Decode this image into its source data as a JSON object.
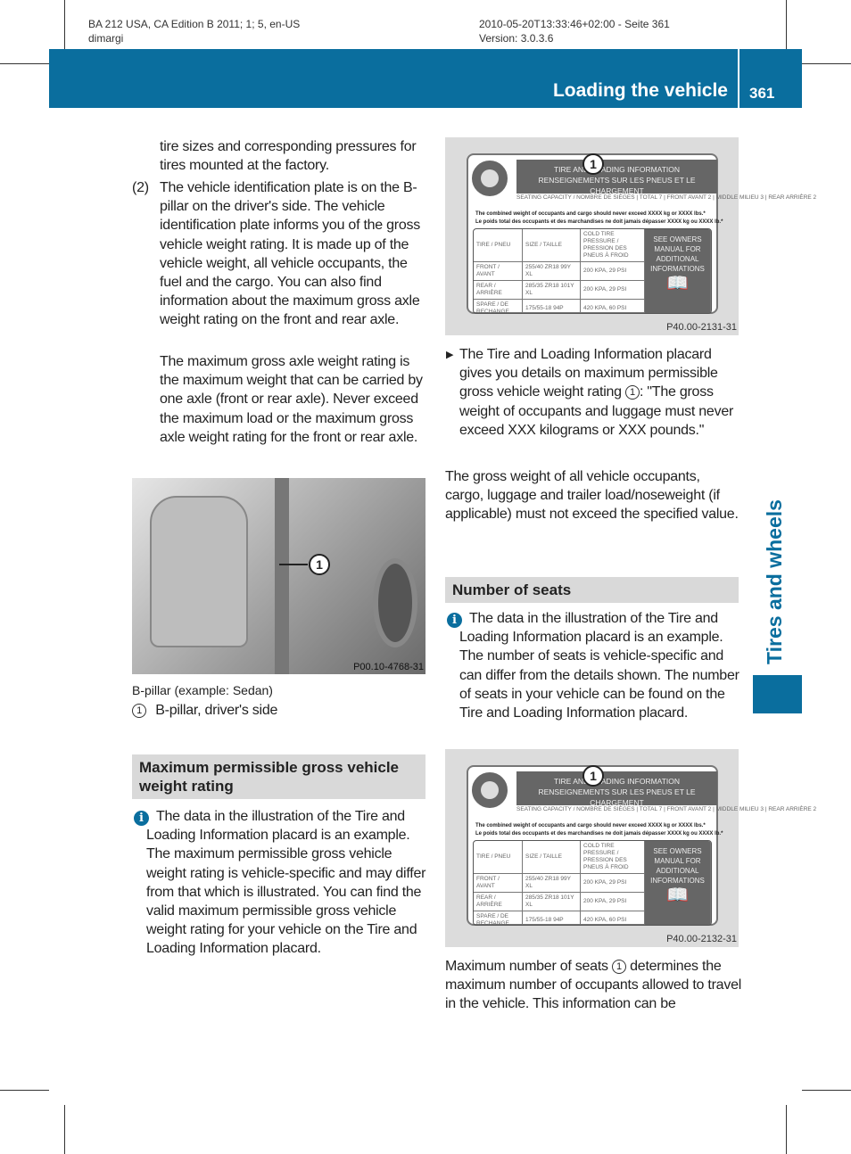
{
  "header": {
    "left_line1": "BA 212 USA, CA Edition B 2011; 1; 5, en-US",
    "left_line2": "dimargi",
    "right_line1": "2010-05-20T13:33:46+02:00 - Seite 361",
    "right_line2": "Version: 3.0.3.6"
  },
  "band": {
    "title": "Loading the vehicle",
    "page": "361",
    "accent": "#0a6e9e"
  },
  "side_tab": "Tires and wheels",
  "left": {
    "p_intro": "tire sizes and corresponding pressures for tires mounted at the factory.",
    "item2_num": "(2)",
    "item2_text": "The vehicle identification plate is on the B-pillar on the driver's side. The vehicle identification plate informs you of the gross vehicle weight rating. It is made up of the vehicle weight, all vehicle occupants, the fuel and the cargo. You can also find information about the maximum gross axle weight rating on the front and rear axle.",
    "item2_para2": "The maximum gross axle weight rating is the maximum weight that can be carried by one axle (front or rear axle). Never exceed the maximum load or the maximum gross axle weight rating for the front or rear axle.",
    "photo_code": "P00.10-4768-31",
    "photo_callout": "1",
    "photo_caption": "B-pillar (example: Sedan)",
    "legend_num": "1",
    "legend_text": "B-pillar, driver's side",
    "section_heading": "Maximum permissible gross vehicle weight rating",
    "info_icon": "i",
    "info_text": "The data in the illustration of the Tire and Loading Information placard is an example. The maximum permissible gross vehicle weight rating is vehicle-specific and may differ from that which is illustrated. You can find the valid maximum permissible gross vehicle weight rating for your vehicle on the Tire and Loading Information placard."
  },
  "placard": {
    "title1": "TIRE AND LOADING INFORMATION",
    "title2": "RENSEIGNEMENTS SUR LES PNEUS ET LE CHARGEMENT",
    "seating": "SEATING CAPACITY / NOMBRE DE SIÈGES | TOTAL 7 | FRONT AVANT 2 | MIDDLE MILIEU 3 | REAR ARRIÈRE 2",
    "combined_en": "The combined weight of occupants and cargo should never exceed XXXX kg or XXXX lbs.*",
    "combined_fr": "Le poids total des occupants et des marchandises ne doit jamais dépasser XXXX kg ou XXXX lb.*",
    "rows": [
      [
        "TIRE / PNEU",
        "SIZE / TAILLE",
        "COLD TIRE PRESSURE / PRESSION DES PNEUS À FROID"
      ],
      [
        "FRONT / AVANT",
        "255/40 ZR18 99Y XL",
        "200 KPA, 29 PSI"
      ],
      [
        "REAR / ARRIÈRE",
        "285/35 ZR18 101Y XL",
        "200 KPA, 29 PSI"
      ],
      [
        "SPARE / DE RECHANGE",
        "175/55-18 94P",
        "420 KPA, 60 PSI"
      ]
    ],
    "see_manual": "SEE OWNERS MANUAL FOR ADDITIONAL INFORMATIONS",
    "callout": "1"
  },
  "right": {
    "fig1_code": "P40.00-2131-31",
    "bullet_text": "The Tire and Loading Information placard gives you details on maximum permissible gross vehicle weight rating ",
    "bullet_num": "1",
    "bullet_text2": ": \"The gross weight of occupants and luggage must never exceed XXX kilograms or XXX pounds.\"",
    "p_gross": "The gross weight of all vehicle occupants, cargo, luggage and trailer load/noseweight (if applicable) must not exceed the specified value.",
    "section_heading": "Number of seats",
    "info_icon": "i",
    "info_text": "The data in the illustration of the Tire and Loading Information placard is an example. The number of seats is vehicle-specific and can differ from the details shown. The number of seats in your vehicle can be found on the Tire and Loading Information placard.",
    "fig2_code": "P40.00-2132-31",
    "p_max_a": "Maximum number of seats ",
    "p_max_num": "1",
    "p_max_b": " determines the maximum number of occupants allowed to travel in the vehicle. This information can be"
  }
}
